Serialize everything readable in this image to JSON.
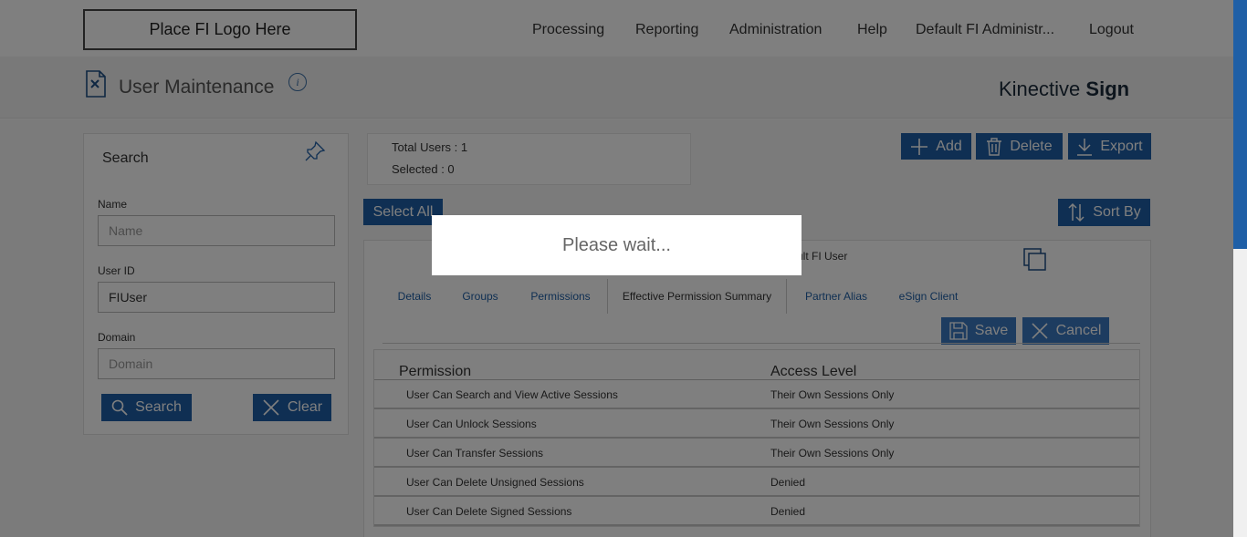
{
  "header": {
    "logo_text": "Place FI Logo Here",
    "nav": [
      "Processing",
      "Reporting",
      "Administration",
      "Help",
      "Default FI Administr...",
      "Logout"
    ]
  },
  "subheader": {
    "title": "User Maintenance",
    "info_glyph": "i",
    "brand_light": "Kinective",
    "brand_bold": "Sign"
  },
  "search": {
    "title": "Search",
    "name_label": "Name",
    "name_placeholder": "Name",
    "name_value": "",
    "userid_label": "User ID",
    "userid_value": "FIUser",
    "domain_label": "Domain",
    "domain_placeholder": "Domain",
    "domain_value": "",
    "search_button": "Search",
    "clear_button": "Clear"
  },
  "summary": {
    "total_users": "Total Users : 1",
    "selected": "Selected : 0"
  },
  "toolbar": {
    "add": "Add",
    "delete": "Delete",
    "export": "Export",
    "select_all": "Select All",
    "sort_by": "Sort By"
  },
  "detail": {
    "user_fragment": "ult FI User",
    "tabs": [
      "Details",
      "Groups",
      "Permissions",
      "Effective Permission Summary",
      "Partner Alias",
      "eSign Client"
    ],
    "active_tab": "Effective Permission Summary",
    "save": "Save",
    "cancel": "Cancel",
    "columns": [
      "Permission",
      "Access Level"
    ],
    "rows": [
      {
        "permission": "User Can Search and View Active Sessions",
        "access": "Their Own Sessions Only"
      },
      {
        "permission": "User Can Unlock Sessions",
        "access": "Their Own Sessions Only"
      },
      {
        "permission": "User Can Transfer Sessions",
        "access": "Their Own Sessions Only"
      },
      {
        "permission": "User Can Delete Unsigned Sessions",
        "access": "Denied"
      },
      {
        "permission": "User Can Delete Signed Sessions",
        "access": "Denied"
      }
    ]
  },
  "modal": {
    "message": "Please wait..."
  },
  "colors": {
    "accent": "#1f5fa6",
    "overlay": "rgba(0,0,0,0.5)"
  }
}
